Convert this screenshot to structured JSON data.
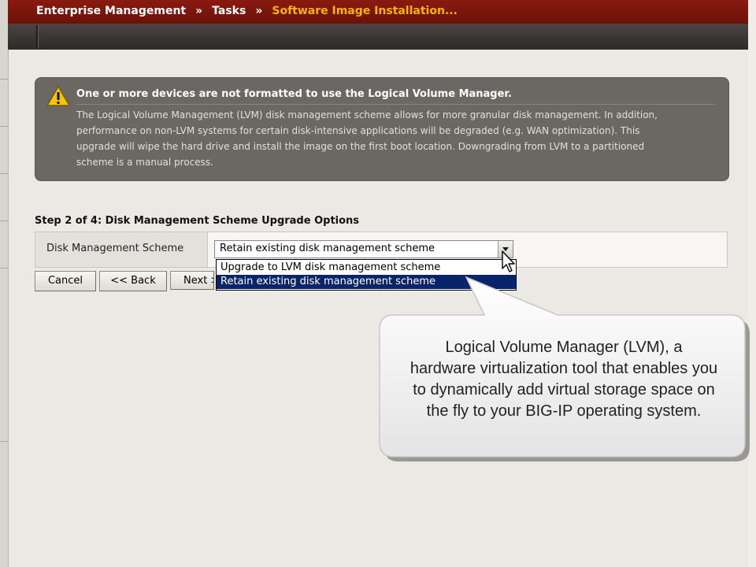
{
  "breadcrumb": {
    "items": [
      "Enterprise Management",
      "Tasks",
      "Software Image Installation..."
    ],
    "separator": "»"
  },
  "warning": {
    "title": "One or more devices are not formatted to use the Logical Volume Manager.",
    "body_lines": [
      "The Logical Volume Management (LVM) disk management scheme allows for more granular disk management. In addition,",
      "performance on non-LVM systems for certain disk-intensive applications will be degraded (e.g. WAN optimization). This",
      "upgrade will wipe the hard drive and install the image on the first boot location. Downgrading from LVM to a partitioned",
      "scheme is a manual process."
    ],
    "icon": "warning-triangle-icon"
  },
  "step": {
    "title": "Step 2 of 4: Disk Management Scheme Upgrade Options"
  },
  "form": {
    "label": "Disk Management Scheme",
    "selected": "Retain existing disk management scheme",
    "options": [
      "Upgrade to LVM disk management scheme",
      "Retain existing disk management scheme"
    ],
    "highlighted_option_index": 1
  },
  "buttons": {
    "cancel": "Cancel",
    "back": "<< Back",
    "next": "Next >"
  },
  "callout": {
    "lines": [
      "Logical Volume Manager (LVM), a",
      "hardware virtualization tool that enables you",
      "to dynamically add virtual storage space on",
      "the fly to your BIG-IP operating system."
    ]
  },
  "colors": {
    "header": "#7a160c",
    "breadcrumb_current": "#f4b400",
    "warning_bg": "#6b6763",
    "selection": "#0a246a"
  }
}
